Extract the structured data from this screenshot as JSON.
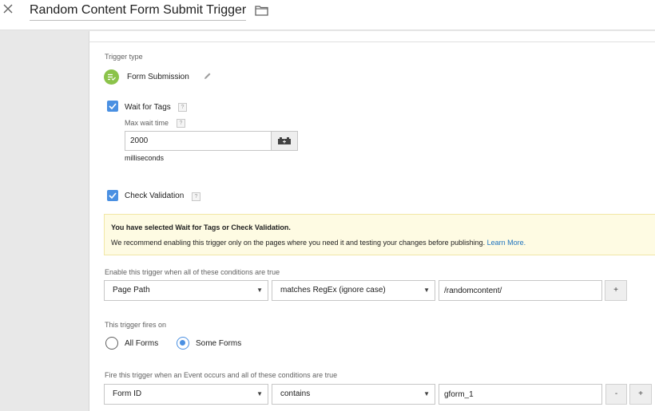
{
  "header": {
    "title": "Random Content Form Submit Trigger"
  },
  "trigger_type": {
    "label": "Trigger type",
    "name": "Form Submission"
  },
  "wait_for_tags": {
    "label": "Wait for Tags",
    "checked": true,
    "help": "?",
    "max_wait_label": "Max wait time",
    "max_wait_value": "2000",
    "unit": "milliseconds"
  },
  "check_validation": {
    "label": "Check Validation",
    "checked": true,
    "help": "?"
  },
  "warning": {
    "title": "You have selected Wait for Tags or Check Validation.",
    "text": "We recommend enabling this trigger only on the pages where you need it and testing your changes before publishing.",
    "link": "Learn More."
  },
  "enable_conditions": {
    "label": "Enable this trigger when all of these conditions are true",
    "variable": "Page Path",
    "operator": "matches RegEx (ignore case)",
    "value": "/randomcontent/",
    "add": "+"
  },
  "fires_on": {
    "label": "This trigger fires on",
    "options": [
      "All Forms",
      "Some Forms"
    ],
    "selected": "Some Forms"
  },
  "event_conditions": {
    "label": "Fire this trigger when an Event occurs and all of these conditions are true",
    "variable": "Form ID",
    "operator": "contains",
    "value": "gform_1",
    "remove": "-",
    "add": "+"
  },
  "colors": {
    "accent": "#4a90e2",
    "trigger_badge": "#8bc34a",
    "warning_bg": "#fefbe3",
    "link": "#1e73be"
  }
}
